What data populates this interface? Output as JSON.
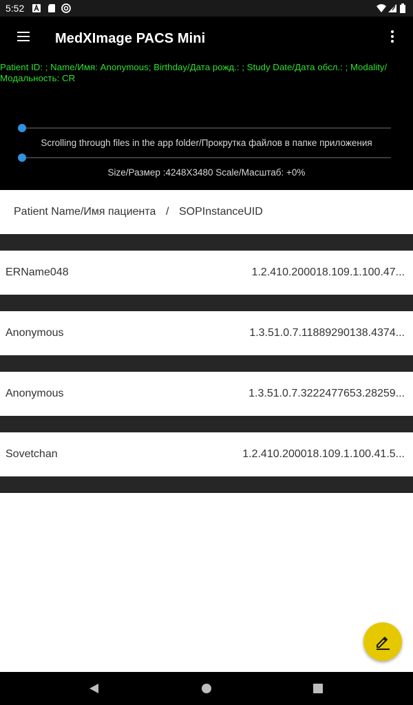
{
  "status_bar": {
    "time": "5:52",
    "icons": [
      "a-notification-icon",
      "sd-card-icon",
      "sync-icon",
      "wifi-icon",
      "signal-icon",
      "battery-icon"
    ]
  },
  "app_bar": {
    "title": "MedXImage PACS Mini",
    "menu_icon": "hamburger-menu-icon",
    "overflow_icon": "more-vert-icon"
  },
  "patient_info": {
    "text": "Patient ID: ;  Name/Имя: Anonymous;  Birthday/Дата рожд.: ;  Study Date/Дата обсл.: ;  Modality/Модальность: CR",
    "color": "#2ee02e"
  },
  "sliders": {
    "top_value": 0,
    "bottom_value": 0,
    "caption": "Scrolling through files in the app folder/Прокрутка файлов в папке приложения",
    "accent": "#2f93e0"
  },
  "image_info": {
    "size_scale": "Size/Размер :4248X3480  Scale/Масштаб: +0%"
  },
  "list_header": {
    "col_name": "Patient Name/Имя пациента",
    "divider": "/",
    "col_uid": "SOPInstanceUID"
  },
  "rows": [
    {
      "name": "ERName048",
      "uid": "1.2.410.200018.109.1.100.47..."
    },
    {
      "name": "Anonymous",
      "uid": "1.3.51.0.7.11889290138.4374..."
    },
    {
      "name": "Anonymous",
      "uid": "1.3.51.0.7.3222477653.28259..."
    },
    {
      "name": "Sovetchan",
      "uid": "1.2.410.200018.109.1.100.41.5..."
    }
  ],
  "fab": {
    "icon": "edit-pencil-icon",
    "color": "#e6c800"
  },
  "nav_bar": {
    "icons": [
      "back-icon",
      "home-icon",
      "recents-icon"
    ]
  }
}
